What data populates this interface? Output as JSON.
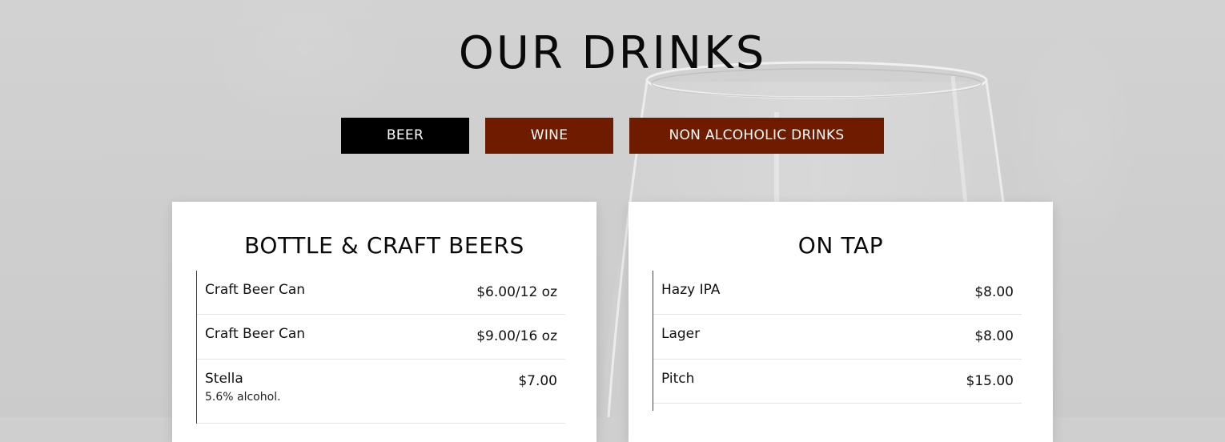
{
  "page": {
    "title": "OUR DRINKS"
  },
  "tabs": [
    {
      "label": "BEER",
      "active": true
    },
    {
      "label": "WINE",
      "active": false
    },
    {
      "label": "NON ALCOHOLIC DRINKS",
      "active": false
    }
  ],
  "colors": {
    "active_tab": "#000000",
    "inactive_tab": "#6e1b00",
    "accent_line": "#b0151a"
  },
  "menus": [
    {
      "title": "BOTTLE & CRAFT BEERS",
      "items": [
        {
          "name": "Craft Beer Can",
          "price": "$6.00/12 oz"
        },
        {
          "name": "Craft Beer Can",
          "price": "$9.00/16 oz"
        },
        {
          "name": "Stella",
          "desc": "5.6% alcohol.",
          "price": "$7.00"
        }
      ]
    },
    {
      "title": "ON TAP",
      "items": [
        {
          "name": "Hazy IPA",
          "price": "$8.00"
        },
        {
          "name": "Lager",
          "price": "$8.00"
        },
        {
          "name": "Pitch",
          "price": "$15.00"
        }
      ]
    }
  ]
}
